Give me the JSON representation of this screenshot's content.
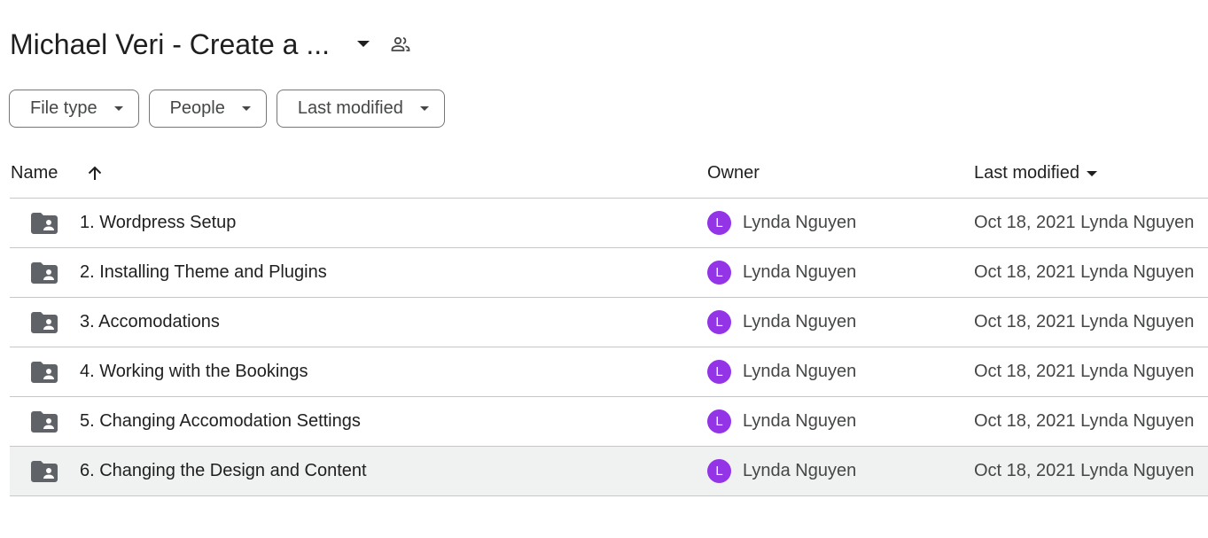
{
  "header": {
    "title": "Michael Veri - Create a ...",
    "dropdown_icon": "arrow-drop-down-icon",
    "shared_icon": "people-icon"
  },
  "filters": [
    {
      "label": "File type"
    },
    {
      "label": "People"
    },
    {
      "label": "Last modified"
    }
  ],
  "table": {
    "columns": {
      "name": "Name",
      "owner": "Owner",
      "last_modified": "Last modified"
    },
    "sort": {
      "column": "Name",
      "direction": "ascending"
    },
    "rows": [
      {
        "name": "1. Wordpress Setup",
        "owner_initial": "L",
        "owner": "Lynda Nguyen",
        "modified": "Oct 18, 2021 Lynda Nguyen"
      },
      {
        "name": "2. Installing Theme and Plugins",
        "owner_initial": "L",
        "owner": "Lynda Nguyen",
        "modified": "Oct 18, 2021 Lynda Nguyen"
      },
      {
        "name": "3. Accomodations",
        "owner_initial": "L",
        "owner": "Lynda Nguyen",
        "modified": "Oct 18, 2021 Lynda Nguyen"
      },
      {
        "name": "4. Working with the Bookings",
        "owner_initial": "L",
        "owner": "Lynda Nguyen",
        "modified": "Oct 18, 2021 Lynda Nguyen"
      },
      {
        "name": "5. Changing Accomodation Settings",
        "owner_initial": "L",
        "owner": "Lynda Nguyen",
        "modified": "Oct 18, 2021 Lynda Nguyen"
      },
      {
        "name": "6. Changing the Design and Content",
        "owner_initial": "L",
        "owner": "Lynda Nguyen",
        "modified": "Oct 18, 2021 Lynda Nguyen"
      }
    ]
  },
  "colors": {
    "avatar": "#9334e6",
    "hover_row": "#f0f1f1",
    "folder_icon": "#5f6368"
  }
}
